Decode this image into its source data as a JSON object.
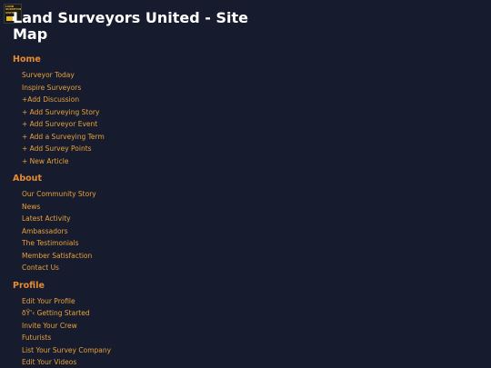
{
  "logo": {
    "text": "LAND SURVEYORS UNITED",
    "icon": "land-surveyors-united-logo"
  },
  "header": {
    "title": "Land Surveyors United - Site Map"
  },
  "sections": [
    {
      "heading": "Home",
      "links": [
        "Surveyor Today",
        "Inspire Surveyors",
        "+Add Discussion",
        "+ Add Surveying Story",
        "+ Add Surveyor Event",
        "+ Add a Surveying Term",
        "+ Add Survey Points",
        "+ New Article"
      ]
    },
    {
      "heading": "About",
      "links": [
        "Our Community Story",
        "News",
        "Latest Activity",
        "Ambassadors",
        "The Testimonials",
        "Member Satisfaction",
        "Contact Us"
      ]
    },
    {
      "heading": "Profile",
      "links": [
        "Edit Your Profile",
        "ðŸ'‹ Getting Started",
        "Invite Your Crew",
        "Futurists",
        "List Your Survey Company",
        "Edit Your Videos"
      ]
    }
  ],
  "colors": {
    "background": "#161c2e",
    "title": "#ffffff",
    "heading": "#e88a2e",
    "link": "#e8a03a"
  }
}
